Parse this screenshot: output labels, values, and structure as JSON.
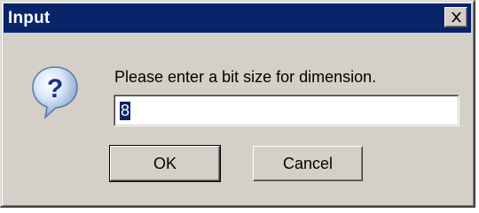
{
  "window": {
    "title": "Input"
  },
  "titlebar": {
    "close_icon": "close-icon"
  },
  "icon": {
    "name": "question-icon"
  },
  "prompt": {
    "text": "Please enter a bit size for dimension."
  },
  "input": {
    "value": "8"
  },
  "buttons": {
    "ok_label": "OK",
    "cancel_label": "Cancel"
  },
  "colors": {
    "titlebar": "#0a246a",
    "dialog_face": "#d4d0c8"
  }
}
